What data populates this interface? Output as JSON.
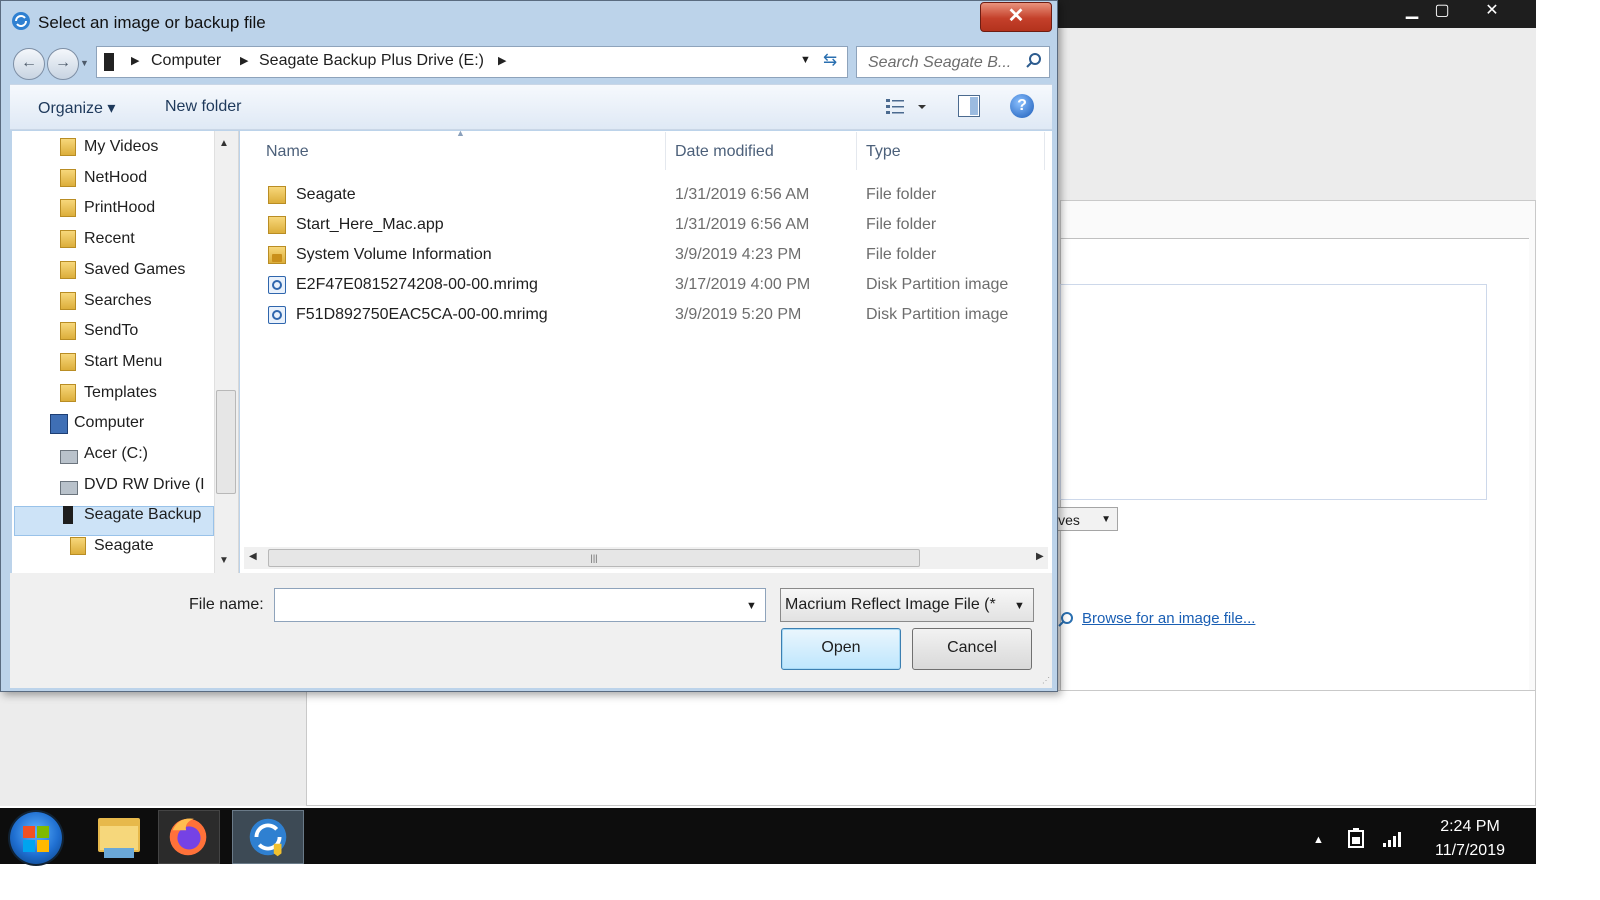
{
  "background_app": {
    "combo_text": "ives",
    "browse_link": "Browse for an image file..."
  },
  "dialog": {
    "title": "Select an image or backup file",
    "close_glyph": "✕",
    "address": {
      "crumbs": [
        "Computer",
        "Seagate Backup Plus Drive (E:)"
      ]
    },
    "search": {
      "placeholder": "Search Seagate B..."
    },
    "toolbar": {
      "organize": "Organize ▾",
      "new_folder": "New folder",
      "help": "?"
    },
    "nav_pane": {
      "items": [
        {
          "label": "My Videos",
          "icon": "videos-folder-icon"
        },
        {
          "label": "NetHood",
          "icon": "shortcut-folder-icon"
        },
        {
          "label": "PrintHood",
          "icon": "shortcut-folder-icon"
        },
        {
          "label": "Recent",
          "icon": "recent-icon"
        },
        {
          "label": "Saved Games",
          "icon": "games-folder-icon"
        },
        {
          "label": "Searches",
          "icon": "search-folder-icon"
        },
        {
          "label": "SendTo",
          "icon": "shortcut-folder-icon"
        },
        {
          "label": "Start Menu",
          "icon": "shortcut-folder-icon"
        },
        {
          "label": "Templates",
          "icon": "shortcut-folder-icon"
        },
        {
          "label": "Computer",
          "icon": "computer-icon"
        },
        {
          "label": "Acer (C:)",
          "icon": "hard-drive-icon"
        },
        {
          "label": "DVD RW Drive (I",
          "icon": "dvd-drive-icon"
        },
        {
          "label": "Seagate Backup",
          "icon": "external-drive-icon"
        },
        {
          "label": "Seagate",
          "icon": "folder-icon"
        }
      ]
    },
    "columns": {
      "name": "Name",
      "date": "Date modified",
      "type": "Type"
    },
    "files": [
      {
        "name": "Seagate",
        "date": "1/31/2019 6:56 AM",
        "type": "File folder",
        "icon": "folder-icon"
      },
      {
        "name": "Start_Here_Mac.app",
        "date": "1/31/2019 6:56 AM",
        "type": "File folder",
        "icon": "folder-icon"
      },
      {
        "name": "System Volume Information",
        "date": "3/9/2019 4:23 PM",
        "type": "File folder",
        "icon": "locked-folder-icon"
      },
      {
        "name": "E2F47E0815274208-00-00.mrimg",
        "date": "3/17/2019 4:00 PM",
        "type": "Disk Partition image",
        "icon": "disk-image-icon"
      },
      {
        "name": "F51D892750EAC5CA-00-00.mrimg",
        "date": "3/9/2019 5:20 PM",
        "type": "Disk Partition image",
        "icon": "disk-image-icon"
      }
    ],
    "file_name_label": "File name:",
    "file_name_value": "",
    "file_type_value": "Macrium Reflect Image File (*",
    "open_button": "Open",
    "cancel_button": "Cancel"
  },
  "taskbar": {
    "time": "2:24 PM",
    "date": "11/7/2019"
  }
}
